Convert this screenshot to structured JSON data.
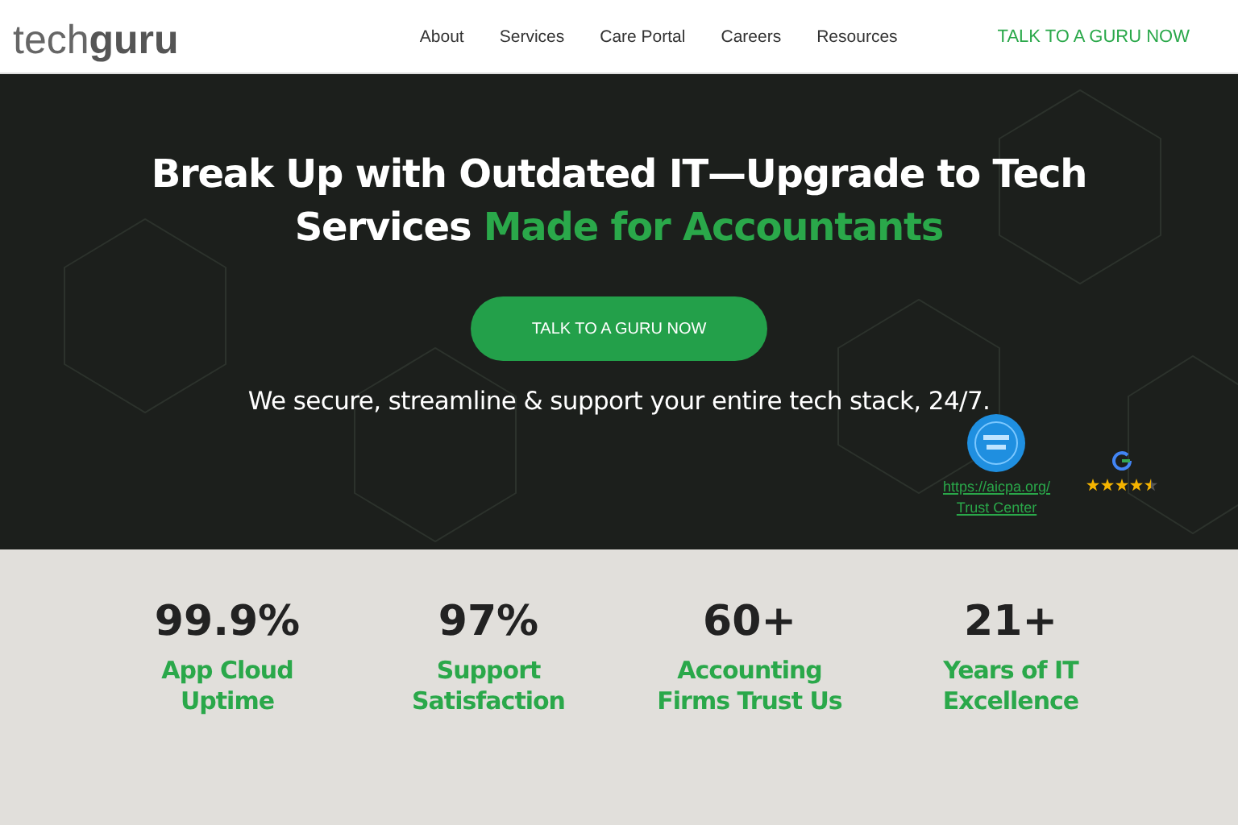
{
  "header": {
    "logo": {
      "light": "tech",
      "bold": "guru"
    },
    "nav": [
      "About",
      "Services",
      "Care Portal",
      "Careers",
      "Resources"
    ],
    "cta": "TALK TO A GURU NOW"
  },
  "hero": {
    "title_line1": "Break Up with Outdated IT—Upgrade to Tech",
    "title_line2_plain": "Services ",
    "title_line2_accent": "Made for Accountants",
    "cta": "TALK TO A GURU NOW",
    "subtitle": "We secure, streamline & support your entire tech stack, 24/7.",
    "badges": {
      "links": [
        "https://aicpa.org/",
        "Trust Center"
      ],
      "stars": 4.5
    }
  },
  "stats": [
    {
      "value": "99.9%",
      "label": "App Cloud Uptime"
    },
    {
      "value": "97%",
      "label": "Support Satisfaction"
    },
    {
      "value": "60+",
      "label": "Accounting Firms Trust Us"
    },
    {
      "value": "21+",
      "label": "Years of IT Excellence"
    }
  ]
}
